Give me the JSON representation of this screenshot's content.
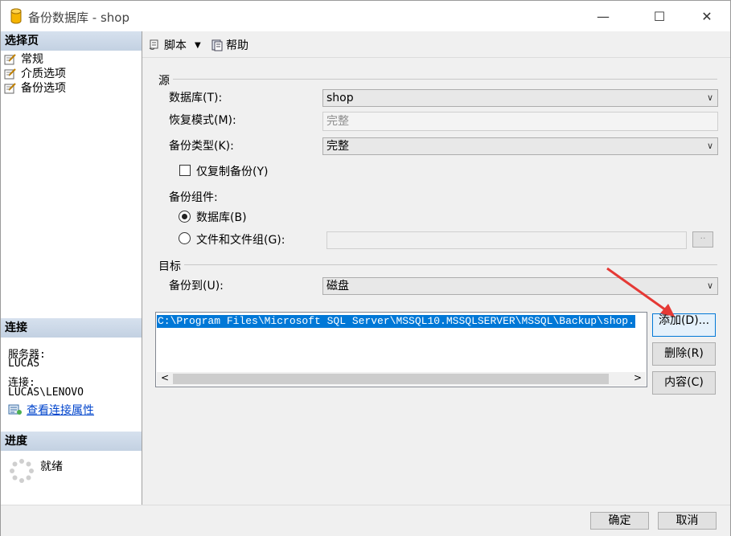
{
  "window": {
    "title": "备份数据库 - shop",
    "controls": {
      "minimize": "—",
      "maximize": "☐",
      "close": "✕"
    }
  },
  "left": {
    "select_page_header": "选择页",
    "pages": [
      {
        "label": "常规",
        "icon": "page-settings-icon"
      },
      {
        "label": "介质选项",
        "icon": "page-settings-icon"
      },
      {
        "label": "备份选项",
        "icon": "page-settings-icon"
      }
    ],
    "connection_header": "连接",
    "server_label": "服务器:",
    "server_value": "LUCAS",
    "connection_label": "连接:",
    "connection_value": "LUCAS\\LENOVO",
    "view_props_link": "查看连接属性",
    "progress_header": "进度",
    "progress_status": "就绪"
  },
  "toolbar": {
    "script_label": "脚本",
    "help_label": "帮助"
  },
  "source": {
    "group_label": "源",
    "database_label": "数据库(T):",
    "database_value": "shop",
    "recovery_label": "恢复模式(M):",
    "recovery_value": "完整",
    "backup_type_label": "备份类型(K):",
    "backup_type_value": "完整",
    "copy_only_label": "仅复制备份(Y)",
    "copy_only_checked": false,
    "component_label": "备份组件:",
    "component_options": [
      {
        "label": "数据库(B)",
        "selected": true
      },
      {
        "label": "文件和文件组(G):",
        "selected": false
      }
    ],
    "files_button": "··"
  },
  "destination": {
    "group_label": "目标",
    "backup_to_label": "备份到(U):",
    "backup_to_value": "磁盘",
    "paths": [
      "C:\\Program Files\\Microsoft SQL Server\\MSSQL10.MSSQLSERVER\\MSSQL\\Backup\\shop."
    ],
    "add_button": "添加(D)...",
    "remove_button": "删除(R)",
    "contents_button": "内容(C)"
  },
  "footer": {
    "ok_button": "确定",
    "cancel_button": "取消"
  },
  "colors": {
    "selection": "#0078d7",
    "header_gradient": "#c3d1e2",
    "annotation_arrow": "#e53935"
  }
}
